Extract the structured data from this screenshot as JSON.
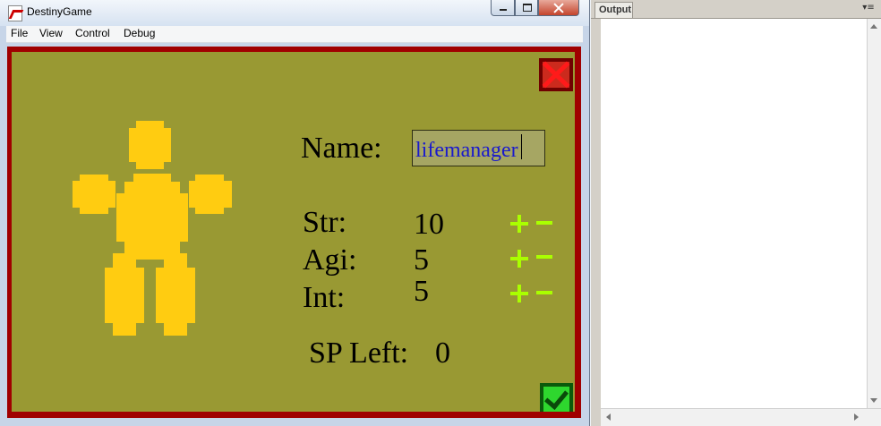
{
  "window": {
    "title": "DestinyGame",
    "menu": [
      "File",
      "View",
      "Control",
      "Debug"
    ]
  },
  "character_creation": {
    "name_label": "Name:",
    "name_value": "lifemanager",
    "stats": [
      {
        "label": "Str:",
        "value": "10"
      },
      {
        "label": "Agi:",
        "value": "5"
      },
      {
        "label": "Int:",
        "value": "5"
      }
    ],
    "sp_left_label": "SP Left:",
    "sp_left_value": "0"
  },
  "colors": {
    "frame": "#a00000",
    "field": "#999933",
    "character": "#ffcc11",
    "stat_buttons": "#aaff00",
    "close_button": "#ff1a1a",
    "confirm_button": "#2ed72e",
    "name_text": "#1a1acc"
  },
  "output_panel": {
    "tab_label": "Output",
    "content": ""
  }
}
